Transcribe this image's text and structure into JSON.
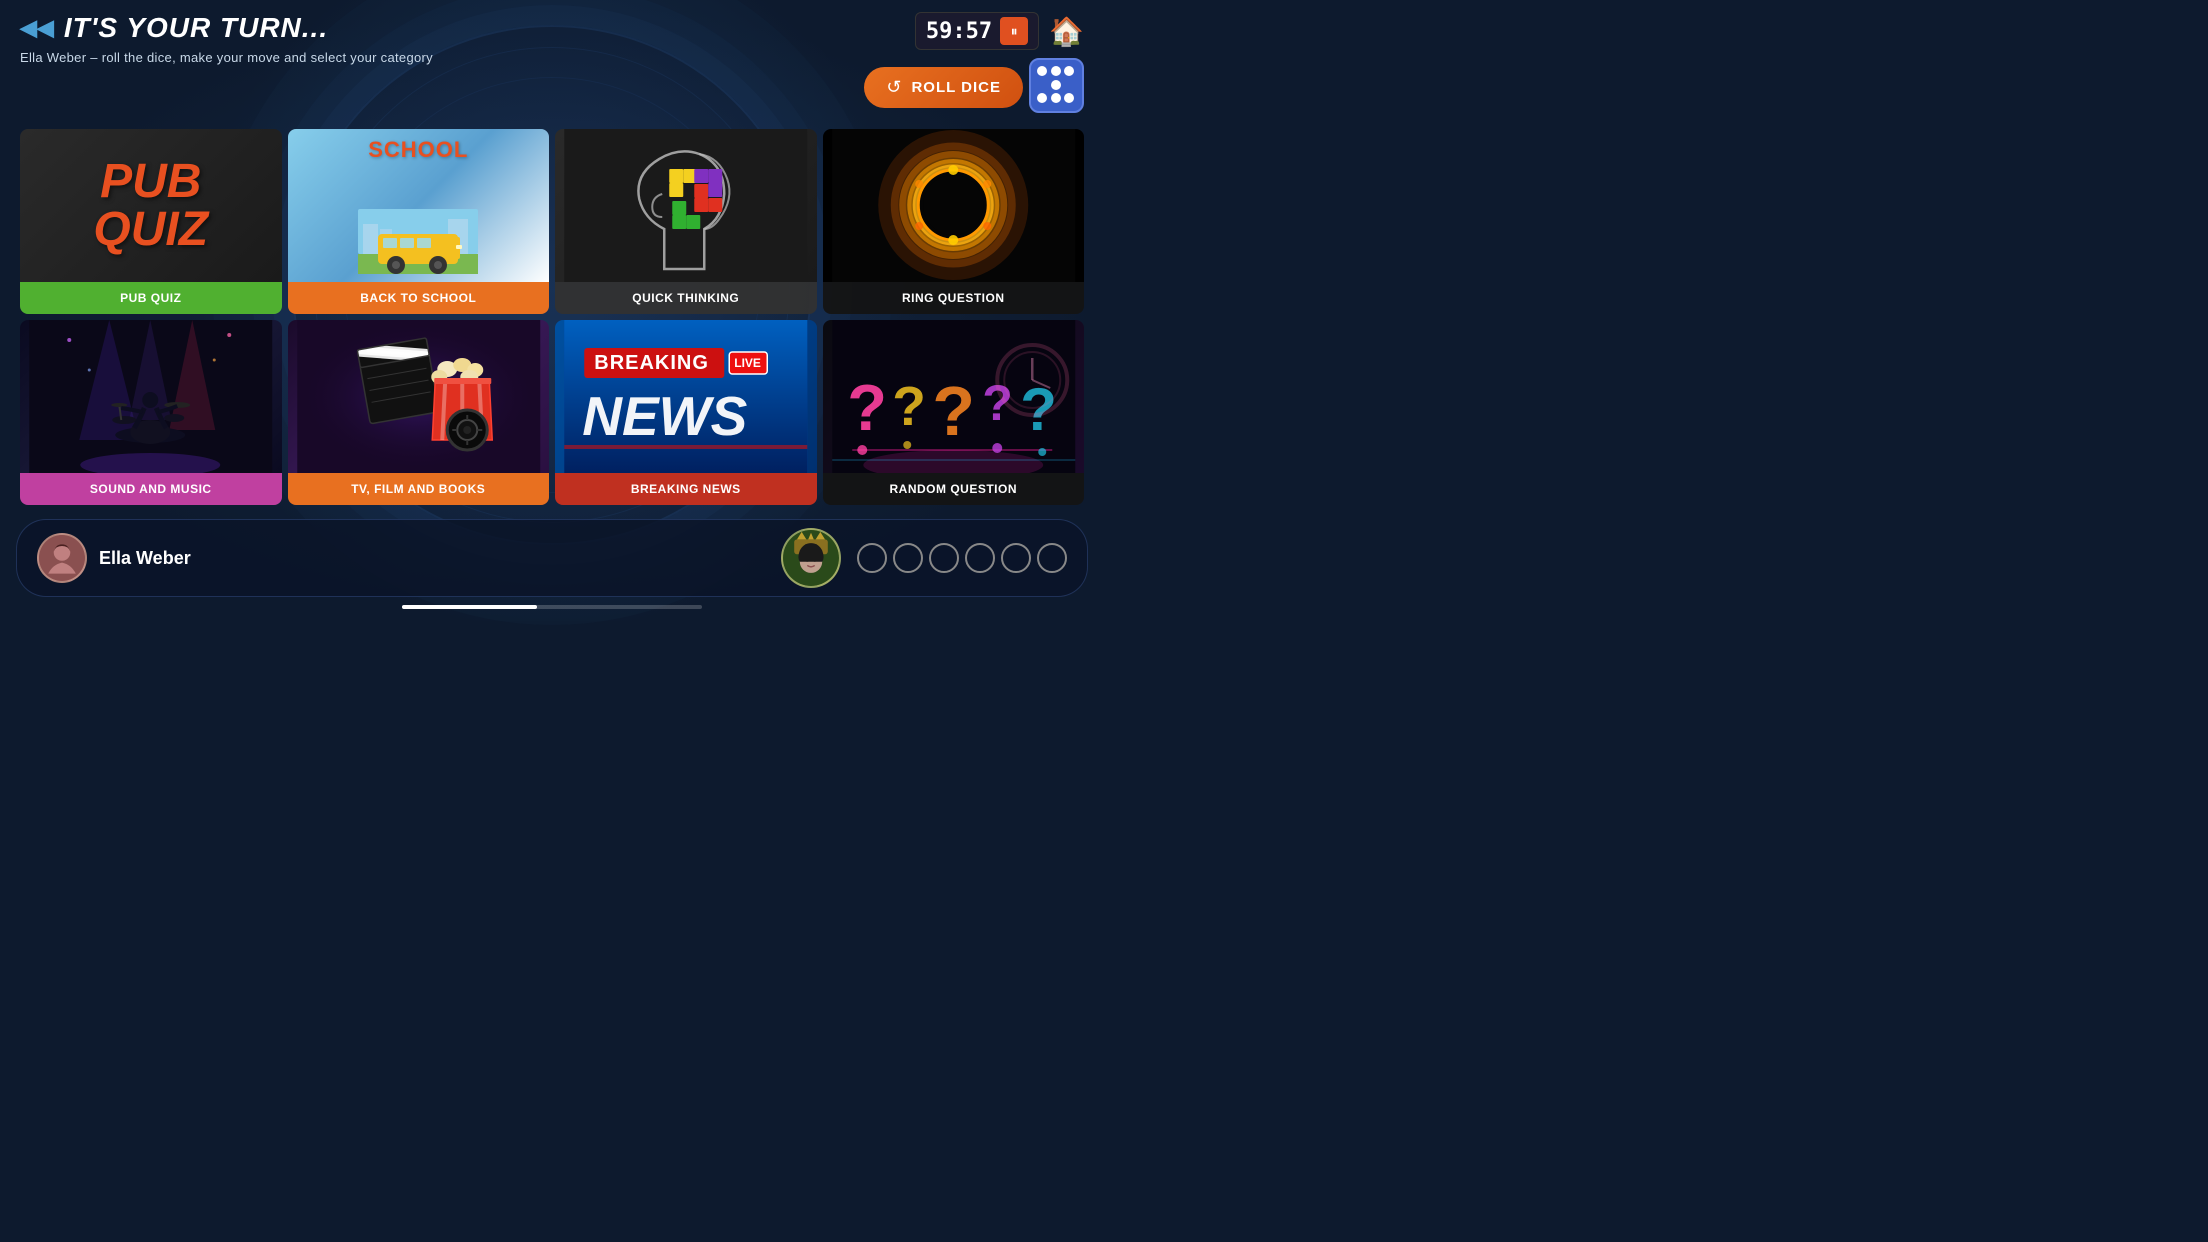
{
  "header": {
    "turn_title": "IT'S YOUR TURN...",
    "subtitle": "Ella Weber – roll the dice, make your move and select your category",
    "timer": "59:57",
    "roll_dice_label": "ROLL DICE",
    "home_label": "Home"
  },
  "categories": [
    {
      "id": "pub-quiz",
      "label": "PUB QUIZ",
      "line1": "PUB",
      "line2": "QUIZ"
    },
    {
      "id": "back-to-school",
      "label": "BACK TO SCHOOL",
      "title": "SCHOOL"
    },
    {
      "id": "quick-thinking",
      "label": "QUICK THINKING"
    },
    {
      "id": "ring-question",
      "label": "RING QUESTION"
    },
    {
      "id": "sound-music",
      "label": "SOUND AND MUSIC"
    },
    {
      "id": "tv-film",
      "label": "TV, FILM AND BOOKS"
    },
    {
      "id": "breaking-news",
      "label": "BREAKING NEWS",
      "breaking": "BREAKING",
      "live": "LIVE",
      "news": "NEWS"
    },
    {
      "id": "random-question",
      "label": "RANDOM QUESTION"
    }
  ],
  "player": {
    "name": "Ella Weber",
    "avatar_emoji": "👩"
  },
  "player2": {
    "avatar_emoji": "🎭"
  }
}
